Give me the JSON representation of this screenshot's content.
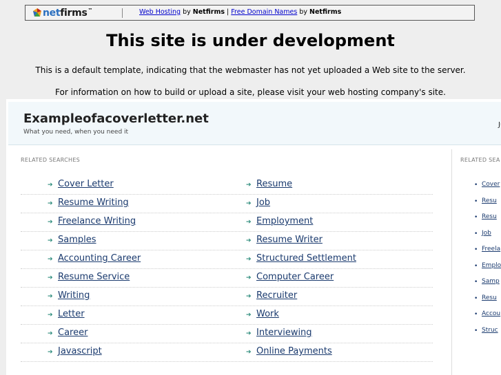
{
  "topbar": {
    "logo_net": "net",
    "logo_firms": "firms",
    "logo_tm": "™",
    "link1": "Web Hosting",
    "by1": "by",
    "brand1": "Netfirms",
    "divider": "|",
    "link2": "Free Domain Names",
    "by2": "by",
    "brand2": "Netfirms"
  },
  "headline": "This site is under development",
  "messages": {
    "line1": "This is a default template, indicating that the webmaster has not yet uploaded a Web site to the server.",
    "line2": "For information on how to build or upload a site, please visit your web hosting company's site."
  },
  "parked": {
    "domain": "Exampleofacoverletter.net",
    "tagline": "What you need, when you need it",
    "right_cut": "Ju",
    "left_heading": "RELATED SEARCHES",
    "right_heading": "RELATED SEA",
    "left_col1": [
      "Cover Letter",
      "Resume Writing",
      "Freelance Writing",
      "Samples",
      "Accounting Career",
      "Resume Service",
      "Writing",
      "Letter",
      "Career",
      "Javascript"
    ],
    "left_col2": [
      "Resume",
      "Job",
      "Employment",
      "Resume Writer",
      "Structured Settlement",
      "Computer Career",
      "Recruiter",
      "Work",
      "Interviewing",
      "Online Payments"
    ],
    "right_list": [
      "Cover",
      "Resu",
      "Resu",
      "Job",
      "Freela",
      "Emplo",
      "Samp",
      "Resu",
      "Accou",
      "Struc"
    ]
  }
}
